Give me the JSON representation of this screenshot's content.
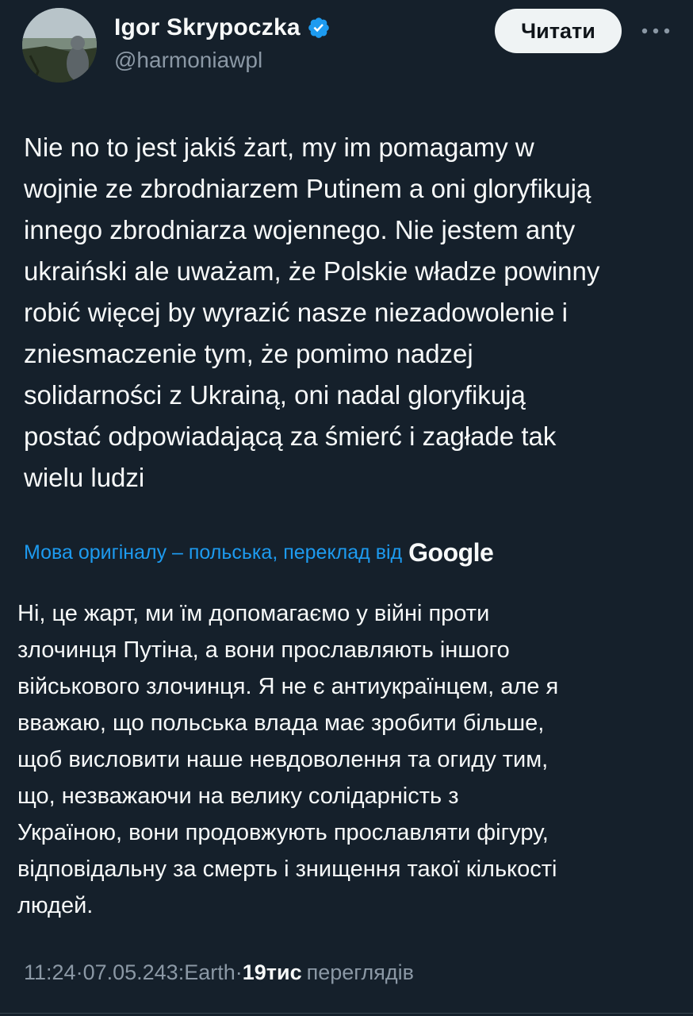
{
  "author": {
    "name": "Igor Skrypoczka",
    "handle": "@harmoniawpl"
  },
  "actions": {
    "read_label": "Читати"
  },
  "post": {
    "text": "Nie no to jest jakiś żart, my im pomagamy w\nwojnie ze zbrodniarzem Putinem a oni gloryfikują\ninnego zbrodniarza wojennego. Nie jestem anty\nukraiński ale uważam, że Polskie władze powinny\nrobić więcej by wyrazić nasze niezadowolenie i\nzniesmaczenie tym, że pomimo nadzej\nsolidarności z Ukrainą, oni nadal gloryfikują\npostać odpowiadającą za śmierć i zagłade tak\nwielu ludzi"
  },
  "translation": {
    "label": "Мова оригіналу – польська, переклад від",
    "provider": "Google",
    "text": "Ні, це жарт, ми їм допомагаємо у війні проти\nзлочинця Путіна, а вони прославляють іншого\nвійськового злочинця. Я не є антиукраїнцем, але я\nвважаю, що польська влада має зробити більше,\nщоб висловити наше невдоволення та огиду тим,\nщо, незважаючи на велику солідарність з\nУкраїною, вони продовжують прославляти фігуру,\nвідповідальну за смерть і знищення такої кількості\nлюдей."
  },
  "meta": {
    "time": "11:24",
    "sep1": " · ",
    "date": "07.05.24",
    "source": " 3:Earth",
    "sep2": " · ",
    "views_count": "19тис",
    "views_label": "переглядів"
  },
  "colors": {
    "background": "#15202b",
    "link": "#1d9bf0",
    "verified": "#1d9bf0",
    "secondary_text": "#8b98a5"
  },
  "icons": [
    "verified-badge-icon",
    "more-options-icon"
  ]
}
